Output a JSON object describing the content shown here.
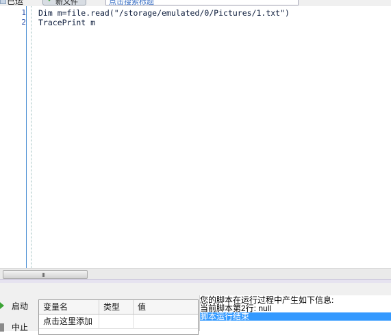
{
  "toolbar": {
    "label_1": "已运",
    "new_file_label": "新文件",
    "search_text": "点击搜索标题"
  },
  "editor": {
    "lines": [
      {
        "number": "1",
        "code": "Dim m=file.read(\"/storage/emulated/0/Pictures/1.txt\")"
      },
      {
        "number": "2",
        "code": "TracePrint m"
      }
    ]
  },
  "scrollbar": {
    "grip": "III"
  },
  "controls": {
    "start_label": "启动",
    "stop_label": "中止"
  },
  "variables": {
    "columns": [
      "变量名",
      "类型",
      "值"
    ],
    "rows": [
      {
        "name": "点击这里添加",
        "type": "",
        "value": ""
      }
    ]
  },
  "output": {
    "lines": [
      "您的脚本在运行过程中产生如下信息:",
      "当前脚本第2行: null",
      "脚本运行结束"
    ]
  },
  "colors": {
    "accent": "#3399ff",
    "line_number": "#2b4fa8",
    "play": "#3ba335"
  }
}
